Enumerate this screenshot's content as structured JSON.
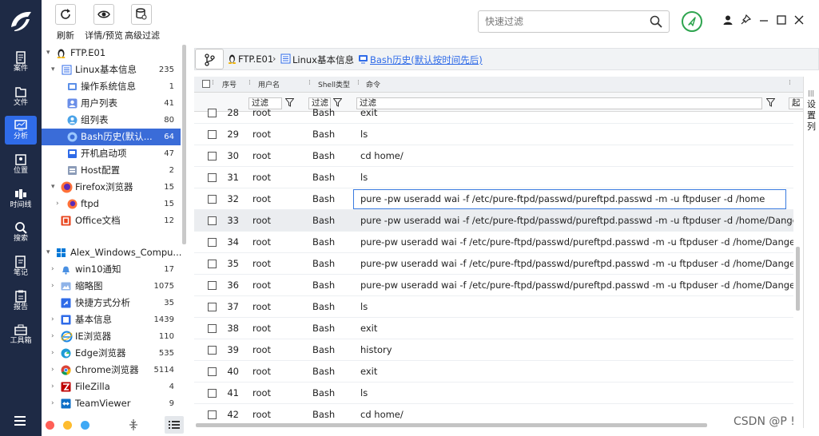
{
  "toolbar": {
    "refresh_label": "刷新",
    "detail_label": "详情/预览",
    "advanced_filter_label": "高级过滤",
    "search_placeholder": "快速过滤"
  },
  "nav": {
    "items": [
      {
        "label": "案件",
        "icon": "case-icon"
      },
      {
        "label": "文件",
        "icon": "file-icon"
      },
      {
        "label": "分析",
        "icon": "analysis-icon",
        "active": true
      },
      {
        "label": "位置",
        "icon": "location-icon"
      },
      {
        "label": "时间线",
        "icon": "timeline-icon"
      },
      {
        "label": "搜索",
        "icon": "search-icon"
      },
      {
        "label": "笔记",
        "icon": "notes-icon"
      },
      {
        "label": "报告",
        "icon": "report-icon"
      },
      {
        "label": "工具箱",
        "icon": "toolbox-icon"
      }
    ]
  },
  "tree": {
    "items": [
      {
        "label": "FTP.E01",
        "count": ""
      },
      {
        "label": "Linux基本信息",
        "count": "235"
      },
      {
        "label": "操作系统信息",
        "count": "1"
      },
      {
        "label": "用户列表",
        "count": "41"
      },
      {
        "label": "组列表",
        "count": "80"
      },
      {
        "label": "Bash历史(默认...",
        "count": "64"
      },
      {
        "label": "开机启动项",
        "count": "47"
      },
      {
        "label": "Host配置",
        "count": "2"
      },
      {
        "label": "Firefox浏览器",
        "count": "15"
      },
      {
        "label": "ftpd",
        "count": "15"
      },
      {
        "label": "Office文档",
        "count": "12"
      },
      {
        "label": "Alex_Windows_Compu...",
        "count": ""
      },
      {
        "label": "win10通知",
        "count": "17"
      },
      {
        "label": "缩略图",
        "count": "1075"
      },
      {
        "label": "快捷方式分析",
        "count": "35"
      },
      {
        "label": "基本信息",
        "count": "1439"
      },
      {
        "label": "IE浏览器",
        "count": "110"
      },
      {
        "label": "Edge浏览器",
        "count": "535"
      },
      {
        "label": "Chrome浏览器",
        "count": "5114"
      },
      {
        "label": "FileZilla",
        "count": "4"
      },
      {
        "label": "TeamViewer",
        "count": "9"
      }
    ]
  },
  "breadcrumb": {
    "root": "FTP.E01",
    "section": "Linux基本信息",
    "current": "Bash历史(默认按时间先后)"
  },
  "grid": {
    "headers": {
      "no": "序号",
      "user": "用户名",
      "shell": "Shell类型",
      "cmd": "命令"
    },
    "filter_label": "过滤",
    "cut_label": "起",
    "side_label": [
      "设",
      "置",
      "列"
    ],
    "rows": [
      {
        "no": "28",
        "user": "root",
        "shell": "Bash",
        "cmd": "exit"
      },
      {
        "no": "29",
        "user": "root",
        "shell": "Bash",
        "cmd": "ls"
      },
      {
        "no": "30",
        "user": "root",
        "shell": "Bash",
        "cmd": "cd home/"
      },
      {
        "no": "31",
        "user": "root",
        "shell": "Bash",
        "cmd": "ls"
      },
      {
        "no": "32",
        "user": "root",
        "shell": "Bash",
        "cmd": "pure -pw useradd wai -f /etc/pure-ftpd/passwd/pureftpd.passwd -m -u ftpduser -d /home"
      },
      {
        "no": "33",
        "user": "root",
        "shell": "Bash",
        "cmd": "pure -pw useradd wai -f /etc/pure-ftpd/passwd/pureftpd.passwd -m -u ftpduser -d /home/Dangerous_Project/"
      },
      {
        "no": "34",
        "user": "root",
        "shell": "Bash",
        "cmd": "pure-pw useradd wai -f /etc/pure-ftpd/passwd/pureftpd.passwd -m -u ftpduser -d /home/Dangerous_Project/"
      },
      {
        "no": "35",
        "user": "root",
        "shell": "Bash",
        "cmd": "pure-pw useradd wai -f /etc/pure-ftpd/passwd/pureftpd.passwd -m -u ftpduser -d /home/Dangerous_Project"
      },
      {
        "no": "36",
        "user": "root",
        "shell": "Bash",
        "cmd": "pure-pw useradd wai -f /etc/pure-ftpd/passwd/pureftpd.passwd -m -u ftpduser -d /home/Dangerous_Project"
      },
      {
        "no": "37",
        "user": "root",
        "shell": "Bash",
        "cmd": "ls"
      },
      {
        "no": "38",
        "user": "root",
        "shell": "Bash",
        "cmd": "exit"
      },
      {
        "no": "39",
        "user": "root",
        "shell": "Bash",
        "cmd": "history"
      },
      {
        "no": "40",
        "user": "root",
        "shell": "Bash",
        "cmd": "exit"
      },
      {
        "no": "41",
        "user": "root",
        "shell": "Bash",
        "cmd": "ls"
      },
      {
        "no": "42",
        "user": "root",
        "shell": "Bash",
        "cmd": "cd home/"
      }
    ]
  },
  "watermark": "CSDN @P !",
  "colors": {
    "nav_bg": "#1e2a45",
    "accent": "#2f6be8",
    "selected_row": "#3a6cd8",
    "ok_green": "#2ea44f"
  }
}
